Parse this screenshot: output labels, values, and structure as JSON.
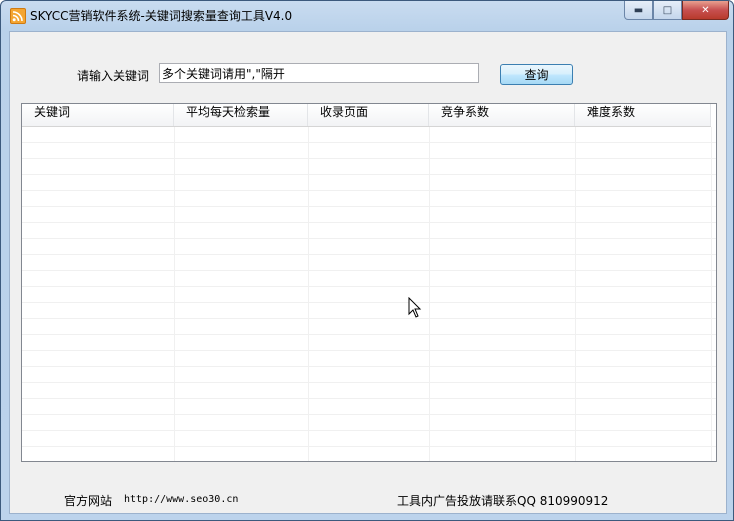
{
  "window": {
    "title": "SKYCC营销软件系统-关键词搜索量查询工具V4.0"
  },
  "icons": {
    "app": "rss-feed-icon",
    "minimize": "minimize-icon",
    "maximize": "maximize-icon",
    "close": "close-icon",
    "cursor": "mouse-pointer-icon"
  },
  "form": {
    "prompt_label": "请输入关键词",
    "keyword_value": "多个关键词请用\",\"隔开",
    "query_button": "查询"
  },
  "table": {
    "columns": [
      "关键词",
      "平均每天检索量",
      "收录页面",
      "竞争系数",
      "难度系数"
    ],
    "rows": []
  },
  "footer": {
    "site_label": "官方网站",
    "site_url": "http://www.seo30.cn",
    "ad_text": "工具内广告投放请联系QQ 810990912"
  },
  "colors": {
    "accent": "#3c7fb1",
    "close_button": "#c75050"
  }
}
